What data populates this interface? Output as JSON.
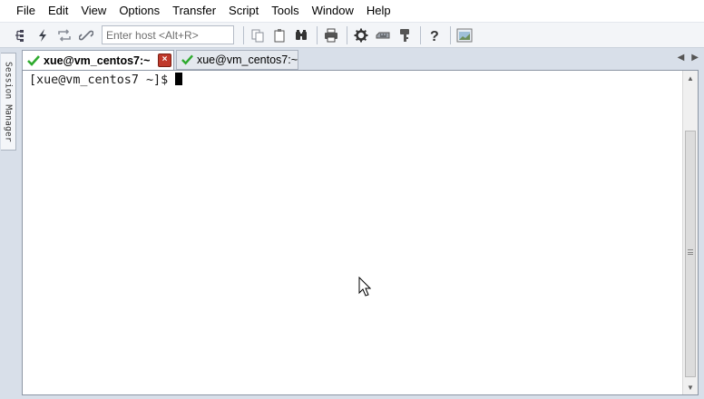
{
  "menu": {
    "items": [
      "File",
      "Edit",
      "View",
      "Options",
      "Transfer",
      "Script",
      "Tools",
      "Window",
      "Help"
    ]
  },
  "toolbar": {
    "host_placeholder": "Enter host <Alt+R>",
    "icons": [
      "connect-in-tab-icon",
      "quick-connect-icon",
      "reconnect-icon",
      "disconnect-icon",
      "copy-icon",
      "paste-icon",
      "find-icon",
      "print-icon",
      "session-options-icon",
      "keymap-icon",
      "keys-icon",
      "help-icon",
      "screenshot-icon"
    ]
  },
  "side_panel": {
    "label": "Session Manager"
  },
  "tabs": [
    {
      "label": "xue@vm_centos7:~",
      "active": true,
      "status_icon": "checkmark-icon"
    },
    {
      "label": "xue@vm_centos7:~",
      "active": false,
      "status_icon": "checkmark-icon"
    }
  ],
  "terminal": {
    "prompt": "[xue@vm_centos7 ~]$ "
  },
  "colors": {
    "accent_green": "#2eaa2e",
    "close_red": "#c0392b",
    "chrome_bg": "#d8dfe9"
  }
}
